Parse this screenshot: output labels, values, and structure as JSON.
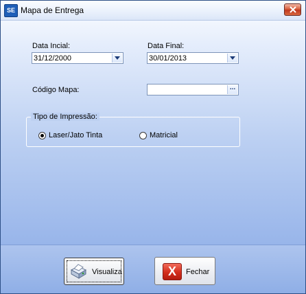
{
  "window": {
    "title": "Mapa de Entrega",
    "app_icon_text": "SE"
  },
  "form": {
    "data_inicial": {
      "label": "Data Incial:",
      "value": "31/12/2000"
    },
    "data_final": {
      "label": "Data Final:",
      "value": "30/01/2013"
    },
    "codigo_mapa": {
      "label": "Código Mapa:",
      "value": "",
      "ellipsis": "..."
    },
    "tipo_impressao": {
      "title": "Tipo de Impressão:",
      "options": [
        {
          "label": "Laser/Jato Tinta",
          "selected": true
        },
        {
          "label": "Matricial",
          "selected": false
        }
      ]
    }
  },
  "buttons": {
    "visualiza": {
      "label": "Visualiza",
      "icon": "printer-icon"
    },
    "fechar": {
      "label": "Fechar",
      "icon": "red-x-icon",
      "icon_glyph": "X"
    }
  },
  "colors": {
    "accent": "#1f5fb8",
    "close_red": "#c0391f",
    "footer_blue": "#9bb7ea"
  }
}
